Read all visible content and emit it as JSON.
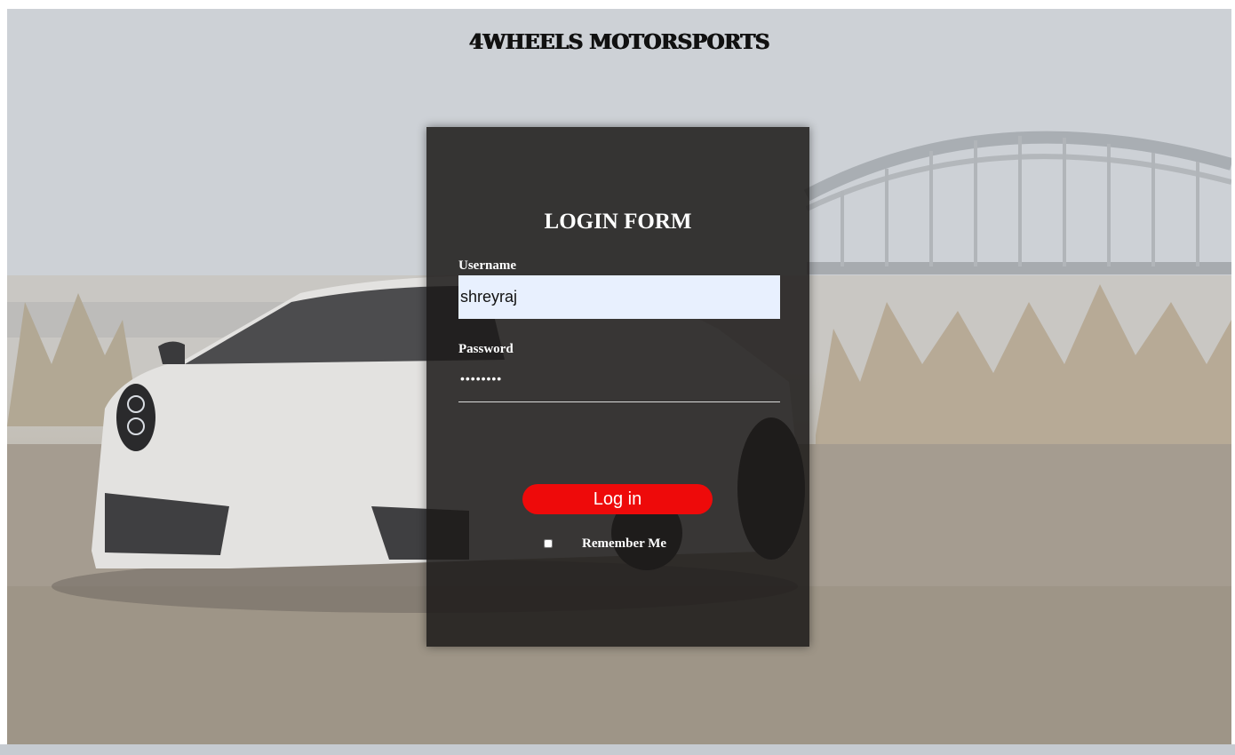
{
  "header": {
    "site_title": "4WHEELS MOTORSPORTS"
  },
  "login_form": {
    "title": "LOGIN FORM",
    "username_label": "Username",
    "username_value": "shreyraj",
    "password_label": "Password",
    "password_value": "••••••••",
    "login_button_label": "Log in",
    "remember_me_label": "Remember Me",
    "remember_me_checked": false
  },
  "colors": {
    "panel_background": "#1c1a19",
    "button_red": "#ee0a0a",
    "autofill_blue": "#e8f0fe",
    "text_white": "#ffffff",
    "title_black": "#111111"
  },
  "icons": {
    "background": "sports-car-bridge-photo"
  }
}
